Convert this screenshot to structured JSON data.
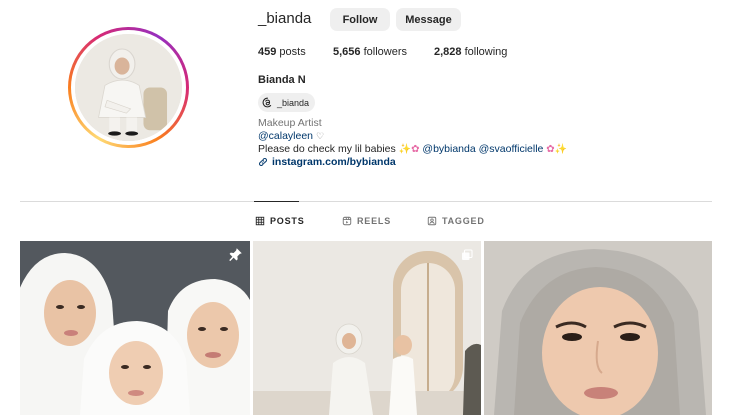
{
  "profile": {
    "username": "_bianda",
    "follow_label": "Follow",
    "message_label": "Message",
    "stats": {
      "posts_count": "459",
      "posts_label": " posts",
      "followers_count": "5,656",
      "followers_label": " followers",
      "following_count": "2,828",
      "following_label": " following"
    },
    "full_name": "Bianda N",
    "threads_handle": "_bianda",
    "category": "Makeup Artist",
    "bio_handle": "@calayleen",
    "bio_text_prefix": "Please do check my lil babies ",
    "bio_mention_1": "@bybianda",
    "bio_mention_2": "@svaofficielle",
    "link": "instagram.com/bybianda"
  },
  "tabs": [
    {
      "label": "POSTS",
      "active": true
    },
    {
      "label": "REELS",
      "active": false
    },
    {
      "label": "TAGGED",
      "active": false
    }
  ],
  "posts": [
    {
      "icon": "pin-icon"
    },
    {
      "icon": "carousel-icon"
    },
    {
      "icon": ""
    }
  ],
  "colors": {
    "link": "#00376b",
    "button_bg": "#efefef",
    "text": "#262626",
    "muted": "#737373"
  }
}
